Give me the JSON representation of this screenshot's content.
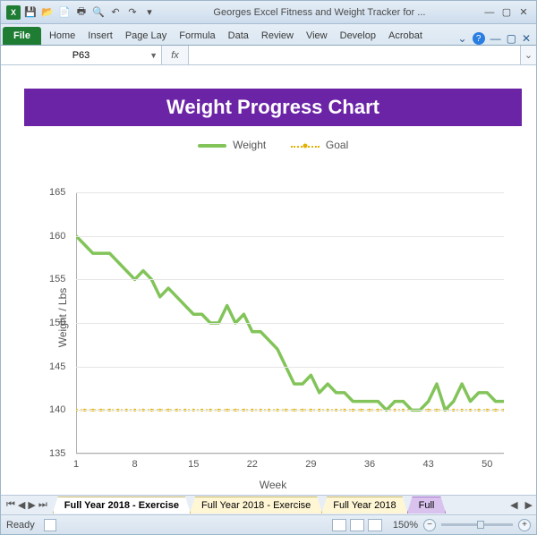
{
  "titlebar": {
    "title": "Georges Excel Fitness and Weight Tracker for ..."
  },
  "ribbon": {
    "file": "File",
    "tabs": [
      "Home",
      "Insert",
      "Page Lay",
      "Formula",
      "Data",
      "Review",
      "View",
      "Develop",
      "Acrobat"
    ]
  },
  "formula": {
    "namebox": "P63",
    "fx": "fx",
    "value": ""
  },
  "chart_data": {
    "type": "line",
    "title": "Weight Progress Chart",
    "xlabel": "Week",
    "ylabel": "Weight / Lbs",
    "ylim": [
      135,
      165
    ],
    "yticks": [
      135,
      140,
      145,
      150,
      155,
      160,
      165
    ],
    "xticks": [
      1,
      8,
      15,
      22,
      29,
      36,
      43,
      50
    ],
    "x": [
      1,
      2,
      3,
      4,
      5,
      6,
      7,
      8,
      9,
      10,
      11,
      12,
      13,
      14,
      15,
      16,
      17,
      18,
      19,
      20,
      21,
      22,
      23,
      24,
      25,
      26,
      27,
      28,
      29,
      30,
      31,
      32,
      33,
      34,
      35,
      36,
      37,
      38,
      39,
      40,
      41,
      42,
      43,
      44,
      45,
      46,
      47,
      48,
      49,
      50,
      51,
      52
    ],
    "series": [
      {
        "name": "Weight",
        "values": [
          160,
          159,
          158,
          158,
          158,
          157,
          156,
          155,
          156,
          155,
          153,
          154,
          153,
          152,
          151,
          151,
          150,
          150,
          152,
          150,
          151,
          149,
          149,
          148,
          147,
          145,
          143,
          143,
          144,
          142,
          143,
          142,
          142,
          141,
          141,
          141,
          141,
          140,
          141,
          141,
          140,
          140,
          141,
          143,
          140,
          141,
          143,
          141,
          142,
          142,
          141,
          141
        ]
      },
      {
        "name": "Goal",
        "values": [
          140,
          140,
          140,
          140,
          140,
          140,
          140,
          140,
          140,
          140,
          140,
          140,
          140,
          140,
          140,
          140,
          140,
          140,
          140,
          140,
          140,
          140,
          140,
          140,
          140,
          140,
          140,
          140,
          140,
          140,
          140,
          140,
          140,
          140,
          140,
          140,
          140,
          140,
          140,
          140,
          140,
          140,
          140,
          140,
          140,
          140,
          140,
          140,
          140,
          140,
          140,
          140
        ]
      }
    ],
    "legend": {
      "weight": "Weight",
      "goal": "Goal"
    }
  },
  "sheettabs": {
    "tabs": [
      "Full Year 2018 - Exercise",
      "Full Year 2018 - Exercise",
      "Full Year 2018",
      "Full"
    ]
  },
  "statusbar": {
    "ready": "Ready",
    "zoom": "150%"
  }
}
